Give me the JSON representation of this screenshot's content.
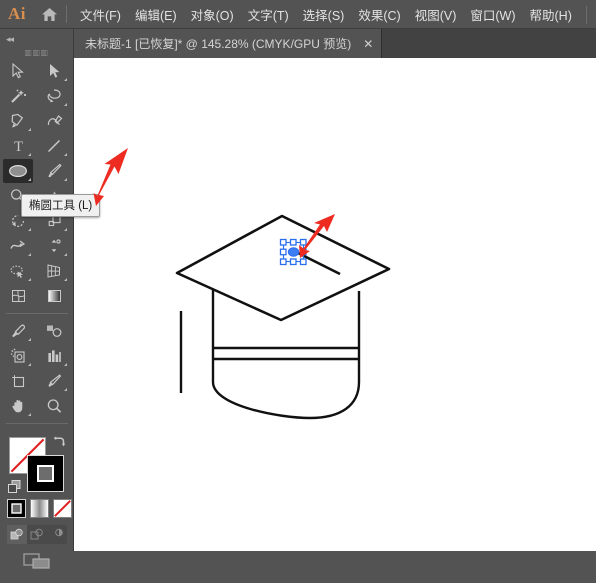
{
  "app": {
    "name": "Ai",
    "logo_color": "#d88e4e",
    "home_icon": "home-icon"
  },
  "menubar": {
    "items": [
      {
        "label": "文件(F)",
        "name": "menu-file"
      },
      {
        "label": "编辑(E)",
        "name": "menu-edit"
      },
      {
        "label": "对象(O)",
        "name": "menu-object"
      },
      {
        "label": "文字(T)",
        "name": "menu-type"
      },
      {
        "label": "选择(S)",
        "name": "menu-select"
      },
      {
        "label": "效果(C)",
        "name": "menu-effect"
      },
      {
        "label": "视图(V)",
        "name": "menu-view"
      },
      {
        "label": "窗口(W)",
        "name": "menu-window"
      },
      {
        "label": "帮助(H)",
        "name": "menu-help"
      }
    ]
  },
  "tabbar": {
    "document_title": "未标题-1 [已恢复]* @ 145.28% (CMYK/GPU 预览)",
    "close_label": "✕",
    "zoom_level": "145.28%",
    "color_mode": "CMYK/GPU 预览",
    "document_name": "未标题-1",
    "document_state": "[已恢复]*"
  },
  "toolbar": {
    "collapse_label": "◂◂",
    "grip_label": "⦀⦀⦀",
    "tools": [
      {
        "name": "selection-tool",
        "icon": "arrow-cursor-icon",
        "has_flyout": false,
        "selected": false
      },
      {
        "name": "direct-selection-tool",
        "icon": "filled-arrow-cursor-icon",
        "has_flyout": true,
        "selected": false
      },
      {
        "name": "magic-wand-tool",
        "icon": "magic-wand-icon",
        "has_flyout": false,
        "selected": false
      },
      {
        "name": "lasso-tool",
        "icon": "lasso-icon",
        "has_flyout": false,
        "selected": false
      },
      {
        "name": "pen-tool",
        "icon": "pen-nib-icon",
        "has_flyout": true,
        "selected": false
      },
      {
        "name": "curvature-tool",
        "icon": "curvature-icon",
        "has_flyout": false,
        "selected": false
      },
      {
        "name": "type-tool",
        "icon": "type-t-icon",
        "has_flyout": true,
        "selected": false
      },
      {
        "name": "line-segment-tool",
        "icon": "line-diagonal-icon",
        "has_flyout": true,
        "selected": false
      },
      {
        "name": "ellipse-tool",
        "icon": "ellipse-icon",
        "has_flyout": true,
        "selected": true
      },
      {
        "name": "paintbrush-tool",
        "icon": "paintbrush-icon",
        "has_flyout": true,
        "selected": false
      },
      {
        "name": "shaper-tool",
        "icon": "shaper-icon",
        "has_flyout": true,
        "selected": false
      },
      {
        "name": "eraser-tool",
        "icon": "eraser-icon",
        "has_flyout": true,
        "selected": false
      },
      {
        "name": "rotate-tool",
        "icon": "rotate-icon",
        "has_flyout": true,
        "selected": false
      },
      {
        "name": "scale-tool",
        "icon": "scale-icon",
        "has_flyout": true,
        "selected": false
      },
      {
        "name": "width-tool",
        "icon": "width-icon",
        "has_flyout": true,
        "selected": false
      },
      {
        "name": "free-transform-tool",
        "icon": "free-transform-icon",
        "has_flyout": true,
        "selected": false
      },
      {
        "name": "shape-builder-tool",
        "icon": "shape-builder-icon",
        "has_flyout": true,
        "selected": false
      },
      {
        "name": "perspective-grid-tool",
        "icon": "perspective-grid-icon",
        "has_flyout": true,
        "selected": false
      },
      {
        "name": "mesh-tool",
        "icon": "mesh-icon",
        "has_flyout": false,
        "selected": false
      },
      {
        "name": "gradient-tool",
        "icon": "gradient-icon",
        "has_flyout": false,
        "selected": false
      },
      {
        "name": "eyedropper-tool",
        "icon": "eyedropper-icon",
        "has_flyout": true,
        "selected": false
      },
      {
        "name": "blend-tool",
        "icon": "blend-icon",
        "has_flyout": false,
        "selected": false
      },
      {
        "name": "symbol-sprayer-tool",
        "icon": "symbol-sprayer-icon",
        "has_flyout": true,
        "selected": false
      },
      {
        "name": "column-graph-tool",
        "icon": "bar-chart-icon",
        "has_flyout": true,
        "selected": false
      },
      {
        "name": "artboard-tool",
        "icon": "artboard-icon",
        "has_flyout": false,
        "selected": false
      },
      {
        "name": "slice-tool",
        "icon": "slice-knife-icon",
        "has_flyout": true,
        "selected": false
      },
      {
        "name": "hand-tool",
        "icon": "hand-icon",
        "has_flyout": true,
        "selected": false
      },
      {
        "name": "zoom-tool",
        "icon": "magnifier-icon",
        "has_flyout": false,
        "selected": false
      }
    ],
    "swatches": {
      "fill_color": "#ffffff",
      "fill_none": true,
      "stroke_color": "#000000",
      "swap_icon": "swap-arrows-icon",
      "default_icon": "default-fill-stroke-icon",
      "modes": [
        {
          "name": "color-mode-button",
          "icon": "solid-color-icon",
          "active": true
        },
        {
          "name": "gradient-mode-button",
          "icon": "gradient-swatch-icon",
          "active": false
        },
        {
          "name": "none-mode-button",
          "icon": "none-swatch-icon",
          "active": false
        }
      ],
      "draw_modes": [
        {
          "name": "draw-normal-button",
          "icon": "draw-normal-icon",
          "active": true
        },
        {
          "name": "draw-behind-button",
          "icon": "draw-behind-icon",
          "active": false
        },
        {
          "name": "draw-inside-button",
          "icon": "draw-inside-icon",
          "active": false
        }
      ],
      "screen_mode": {
        "name": "change-screen-mode-button",
        "icon": "screen-mode-icon"
      }
    }
  },
  "tooltip": {
    "text": "椭圆工具 (L)",
    "target": "ellipse-tool"
  },
  "canvas": {
    "background": "#ffffff",
    "artwork_name": "graduation-cap-drawing",
    "stroke_color": "#000000",
    "selection_color": "#2a6ef0",
    "selected_object": "small-ellipse",
    "annotation_color": "#ee2b20",
    "annotations": [
      {
        "name": "arrow-to-tooltip",
        "points_at": "ellipse-tool-tooltip"
      },
      {
        "name": "arrow-to-selected-ellipse",
        "points_at": "selected-ellipse-on-artboard"
      }
    ]
  }
}
